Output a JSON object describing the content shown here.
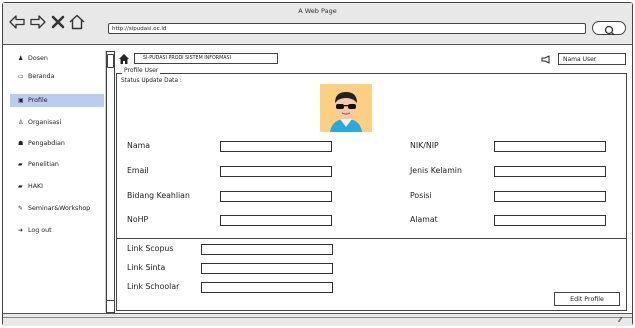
{
  "window": {
    "title": "A Web Page"
  },
  "browser": {
    "url": "http://sipudasi.oc.id"
  },
  "sidebar": {
    "items": [
      {
        "label": "Dosen",
        "icon": "person-icon",
        "glyph": "♟",
        "active": false
      },
      {
        "label": "Beranda",
        "icon": "home-icon",
        "glyph": "▭",
        "active": false
      },
      {
        "label": "Profile",
        "icon": "id-card-icon",
        "glyph": "▣",
        "active": true
      },
      {
        "label": "Organisasi",
        "icon": "sitemap-icon",
        "glyph": "♙",
        "active": false
      },
      {
        "label": "Pengabdian",
        "icon": "users-icon",
        "glyph": "☗",
        "active": false
      },
      {
        "label": "Penelitian",
        "icon": "book-icon",
        "glyph": "▰",
        "active": false
      },
      {
        "label": "HAKI",
        "icon": "book-icon",
        "glyph": "▰",
        "active": false
      },
      {
        "label": "Seminar&Workshop",
        "icon": "pencil-icon",
        "glyph": "✎",
        "active": false
      },
      {
        "label": "Log out",
        "icon": "logout-icon",
        "glyph": "➜",
        "active": false
      }
    ]
  },
  "header": {
    "breadcrumb": "SI-PUDASI PRODI SISTEM INFORMASI",
    "user_name": "Nama User"
  },
  "profile": {
    "legend": "Profile User",
    "status_label": "Status Update Data :",
    "left_fields": [
      "Nama",
      "Email",
      "Bidang Keahlian",
      "NoHP"
    ],
    "right_fields": [
      "NIK/NIP",
      "Jenis Kelamin",
      "Posisi",
      "Alamat"
    ],
    "links": [
      "Link Scopus",
      "Link Sinta",
      "Link Schoolar"
    ],
    "edit_button": "Edit Profile"
  }
}
